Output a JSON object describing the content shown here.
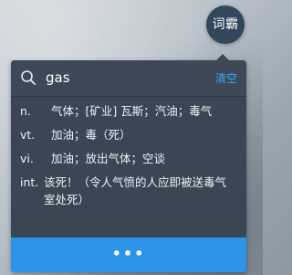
{
  "app": {
    "logo_label": "词霸",
    "accent_color": "#2c95ea"
  },
  "search": {
    "query": "gas",
    "clear_label": "清空",
    "icon": "search-icon"
  },
  "definitions": [
    {
      "pos": "n.",
      "text": "气体；[矿业] 瓦斯；汽油；毒气"
    },
    {
      "pos": "vt.",
      "text": "加油；毒（死）"
    },
    {
      "pos": "vi.",
      "text": "加油；放出气体；空谈"
    },
    {
      "pos": "int.",
      "text": "该死！（令人气愤的人应即被送毒气室处死）"
    }
  ],
  "more": {
    "label": "•••"
  }
}
